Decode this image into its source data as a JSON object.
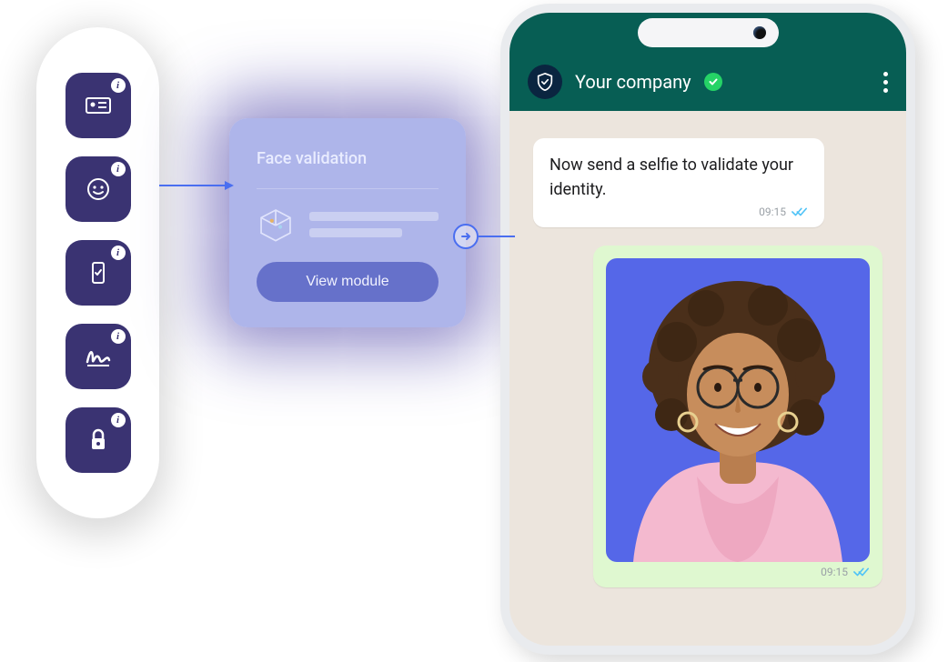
{
  "modules": {
    "items": [
      {
        "name": "id-card-icon",
        "label": "ID card"
      },
      {
        "name": "face-icon",
        "label": "Face"
      },
      {
        "name": "device-check-icon",
        "label": "Device check"
      },
      {
        "name": "signature-icon",
        "label": "Signature"
      },
      {
        "name": "lock-icon",
        "label": "Lock"
      }
    ]
  },
  "card": {
    "title": "Face validation",
    "button_label": "View module"
  },
  "chat": {
    "company_name": "Your company",
    "messages": {
      "incoming": {
        "text": "Now send a selfie to validate your identity.",
        "time": "09:15"
      },
      "outgoing": {
        "time": "09:15"
      }
    }
  },
  "colors": {
    "module_tile": "#3a3372",
    "arrow": "#4a6ef0",
    "whatsapp_header": "#075E54",
    "verified_badge": "#25D366",
    "chat_bg": "#ECE5DD",
    "outgoing_bubble": "#dff8d0",
    "selfie_bg": "#5567e8"
  }
}
